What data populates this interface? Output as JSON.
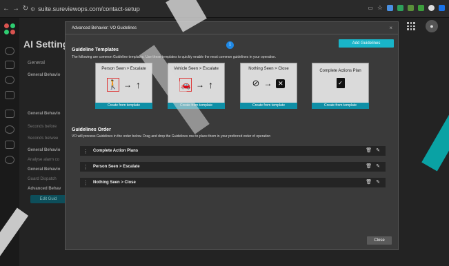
{
  "browser": {
    "url": "suite.sureviewops.com/contact-setup"
  },
  "background": {
    "page_title": "AI Setting",
    "tab_general": "General",
    "rows": [
      "General Behavio",
      "General Behavio",
      "Seconds before",
      "Seconds betwee",
      "General Behavio",
      "Analyse alarm co",
      "General Behavio",
      "Guard Dispatch",
      "Advanced Behav"
    ],
    "edit_button": "Edit Guid"
  },
  "modal": {
    "title": "Advanced Behavior: VO Guidelines",
    "badge": "1",
    "add_button": "Add Guidelines",
    "templates_title": "Guideline Templates",
    "templates_desc": "The following are common Guideline templates. Use these templates to quickly enable the most common guidelines in your operation.",
    "templates": [
      {
        "name": "Person Seen > Escalate",
        "button": "Create from template",
        "icon": "person-walking-icon"
      },
      {
        "name": "Vehicle Seen > Escalate",
        "button": "Create from template",
        "icon": "car-icon"
      },
      {
        "name": "Nothing Seen > Close",
        "button": "Create from template",
        "icon": "person-off-icon"
      },
      {
        "name": "Complete Actions Plan",
        "button": "Create from template",
        "icon": "clipboard-check-icon"
      }
    ],
    "order_title": "Guidelines Order",
    "order_desc": "VO will process Guidelines in the order below. Drag and drop the Guidelines row to place them in your preferred order of operation",
    "order_rows": [
      {
        "label": "Complete Action Plans"
      },
      {
        "label": "Person Seen > Escalate"
      },
      {
        "label": "Nothing Seen > Close"
      }
    ],
    "close_button": "Close"
  },
  "colors": {
    "accent": "#19b5c9",
    "template_button": "#0f8fa6",
    "badge": "#1e88e5"
  }
}
